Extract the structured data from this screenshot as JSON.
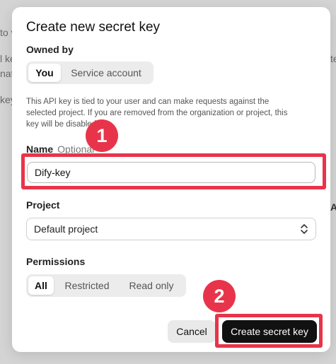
{
  "background": {
    "fragments": [
      "to v",
      "l ke",
      "nat",
      "key c",
      "te",
      "Al"
    ]
  },
  "dialog": {
    "title": "Create new secret key",
    "owned_by": {
      "label": "Owned by",
      "options": [
        "You",
        "Service account"
      ],
      "selected": "You"
    },
    "help_text": "This API key is tied to your user and can make requests against the selected project. If you are removed from the organization or project, this key will be disabled.",
    "name": {
      "label": "Name",
      "optional_label": "Optional",
      "value": "Dify-key"
    },
    "project": {
      "label": "Project",
      "value": "Default project",
      "icon": "chevron-up-down-icon"
    },
    "permissions": {
      "label": "Permissions",
      "options": [
        "All",
        "Restricted",
        "Read only"
      ],
      "selected": "All"
    },
    "buttons": {
      "cancel": "Cancel",
      "create": "Create secret key"
    }
  },
  "annotations": {
    "marker_1": "1",
    "marker_2": "2",
    "color": "#e8344a"
  }
}
